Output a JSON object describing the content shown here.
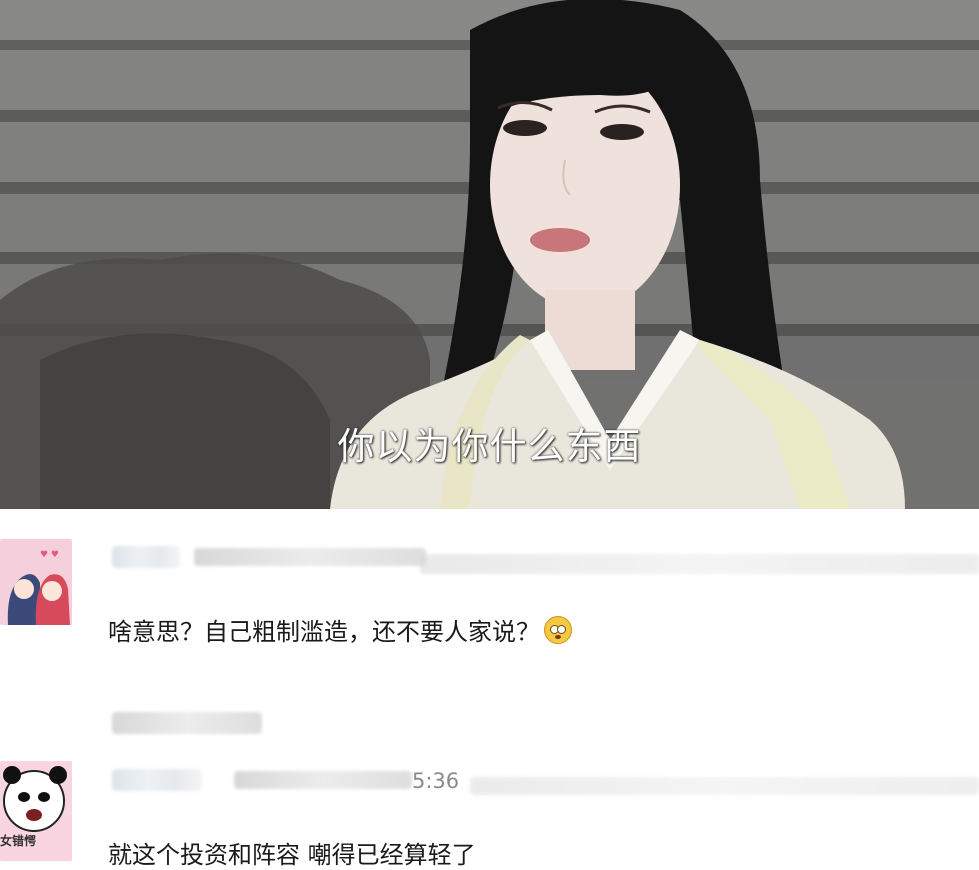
{
  "scene": {
    "subtitle": "你以为你什么东西"
  },
  "comments": [
    {
      "username_hidden": true,
      "text": "啥意思？自己粗制滥造，还不要人家说？",
      "emoji": "flushed-face-emoji"
    },
    {
      "username_hidden": true,
      "time_fragment": "5:36",
      "text": "就这个投资和阵容 嘲得已经算轻了",
      "avatar_caption": "女错愕"
    }
  ],
  "colors": {
    "background": "#ffffff",
    "text": "#1a1a1a",
    "meta_text": "#8a8a8a",
    "blur_bar": "#dce4ea"
  }
}
